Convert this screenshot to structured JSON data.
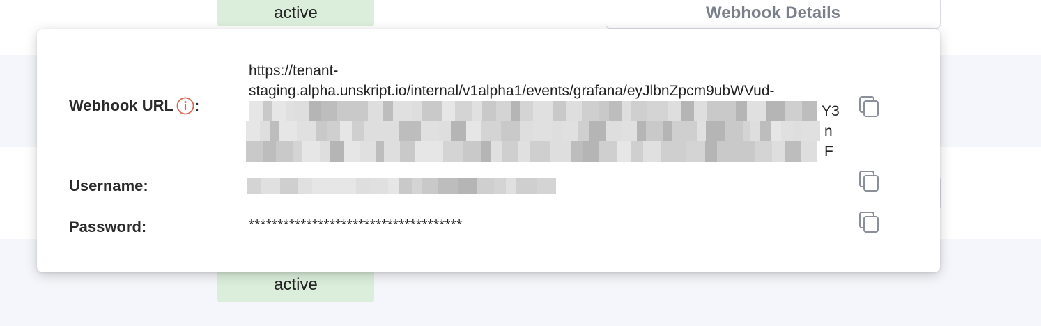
{
  "background": {
    "status_top": "active",
    "status_bottom": "active",
    "details_button": "Webhook Details"
  },
  "popup": {
    "webhook_url_label": "Webhook URL",
    "label_colon": ":",
    "webhook_url_line1": "https://tenant-",
    "webhook_url_line2": "staging.alpha.unskript.io/internal/v1alpha1/events/grafana/eyJlbnZpcm9ubWVud-",
    "webhook_url_tail_line3": "Y3",
    "webhook_url_tail_line4": "nF",
    "username_label": "Username:",
    "password_label": "Password:",
    "password_value": "*************************************"
  },
  "icons": {
    "info": "info-circle-icon",
    "copy": "copy-icon"
  },
  "colors": {
    "info_icon": "#d9674f",
    "status_pill": "#dbeedb",
    "row_alt": "#f5f6fb",
    "copy_icon": "#8a8f99"
  }
}
